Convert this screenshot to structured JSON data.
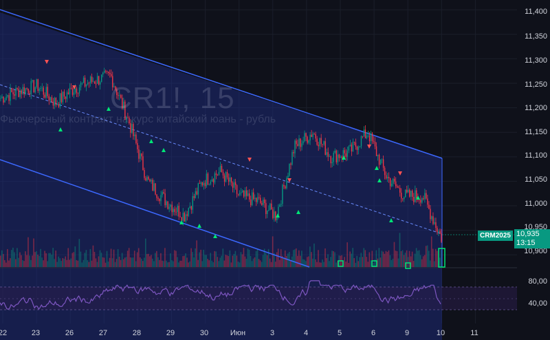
{
  "watermark": {
    "symbol": "CR1!, 15",
    "description": "Фьючерсный контракт на курс китайский юань - рубль"
  },
  "price_axis": {
    "ticks": [
      "11,400",
      "11,350",
      "11,300",
      "11,250",
      "11,200",
      "11,150",
      "11,100",
      "11,050",
      "11,000",
      "10,950",
      "10,900"
    ]
  },
  "rsi_axis": {
    "ticks": [
      "80,00",
      "40,00"
    ]
  },
  "time_axis": {
    "ticks": [
      "22",
      "23",
      "26",
      "27",
      "28",
      "29",
      "30",
      "Июн",
      "3",
      "4",
      "5",
      "6",
      "9",
      "10",
      "11"
    ]
  },
  "last_price": {
    "symbol": "CRM2025",
    "price": "10,935",
    "countdown": "13:15"
  },
  "colors": {
    "background": "#0f111a",
    "channel_fill": "#1e2f8a",
    "channel_line": "#3c68ff",
    "up": "#089981",
    "down": "#f23645",
    "rsi": "#7e57c2",
    "signal_up": "#00e676",
    "signal_down": "#ff5252"
  },
  "chart_data": {
    "type": "line",
    "title": "",
    "x": [
      "22",
      "23",
      "26",
      "27",
      "28",
      "29",
      "30",
      "Июн",
      "3",
      "4",
      "5",
      "6",
      "9",
      "10",
      "11"
    ],
    "ylim": [
      10875,
      11420
    ],
    "series": [
      {
        "values": [
          11220,
          11235,
          11245,
          11210,
          11240,
          11255,
          11265,
          11170,
          11050,
          11010,
          10980,
          11050,
          11070,
          11020,
          11010,
          10980,
          11120,
          11150,
          11100,
          11110,
          11150,
          11060,
          11020,
          11020,
          10935
        ]
      }
    ],
    "rsi_ylim": [
      20,
      90
    ],
    "rsi_ticks": [
      80,
      40
    ]
  }
}
